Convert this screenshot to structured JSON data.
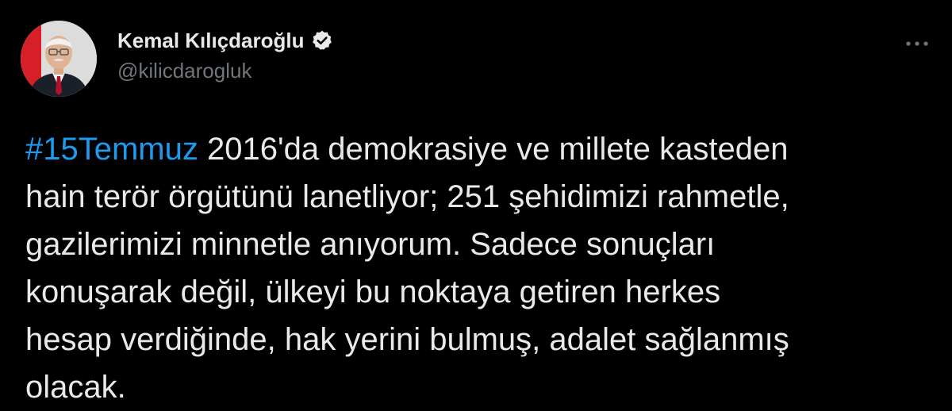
{
  "author": {
    "display_name": "Kemal Kılıçdaroğlu",
    "handle": "@kilicdarogluk",
    "verified": true,
    "avatar_icon": "profile-photo"
  },
  "menu": {
    "icon": "more-horizontal-icon"
  },
  "tweet": {
    "hashtag": "#15Temmuz",
    "line1_rest": " 2016'da demokrasiye ve millete kasteden",
    "line2": "hain terör örgütünü lanetliyor; 251 şehidimizi rahmetle,",
    "line3": "gazilerimizi minnetle anıyorum. Sadece sonuçları",
    "line4": "konuşarak değil, ülkeyi bu noktaya getiren herkes",
    "line5": "hesap verdiğinde, hak yerini bulmuş, adalet sağlanmış",
    "line6": "olacak."
  },
  "colors": {
    "background": "#000000",
    "text": "#e7e9ea",
    "secondary": "#71767b",
    "link": "#1d9bf0"
  }
}
